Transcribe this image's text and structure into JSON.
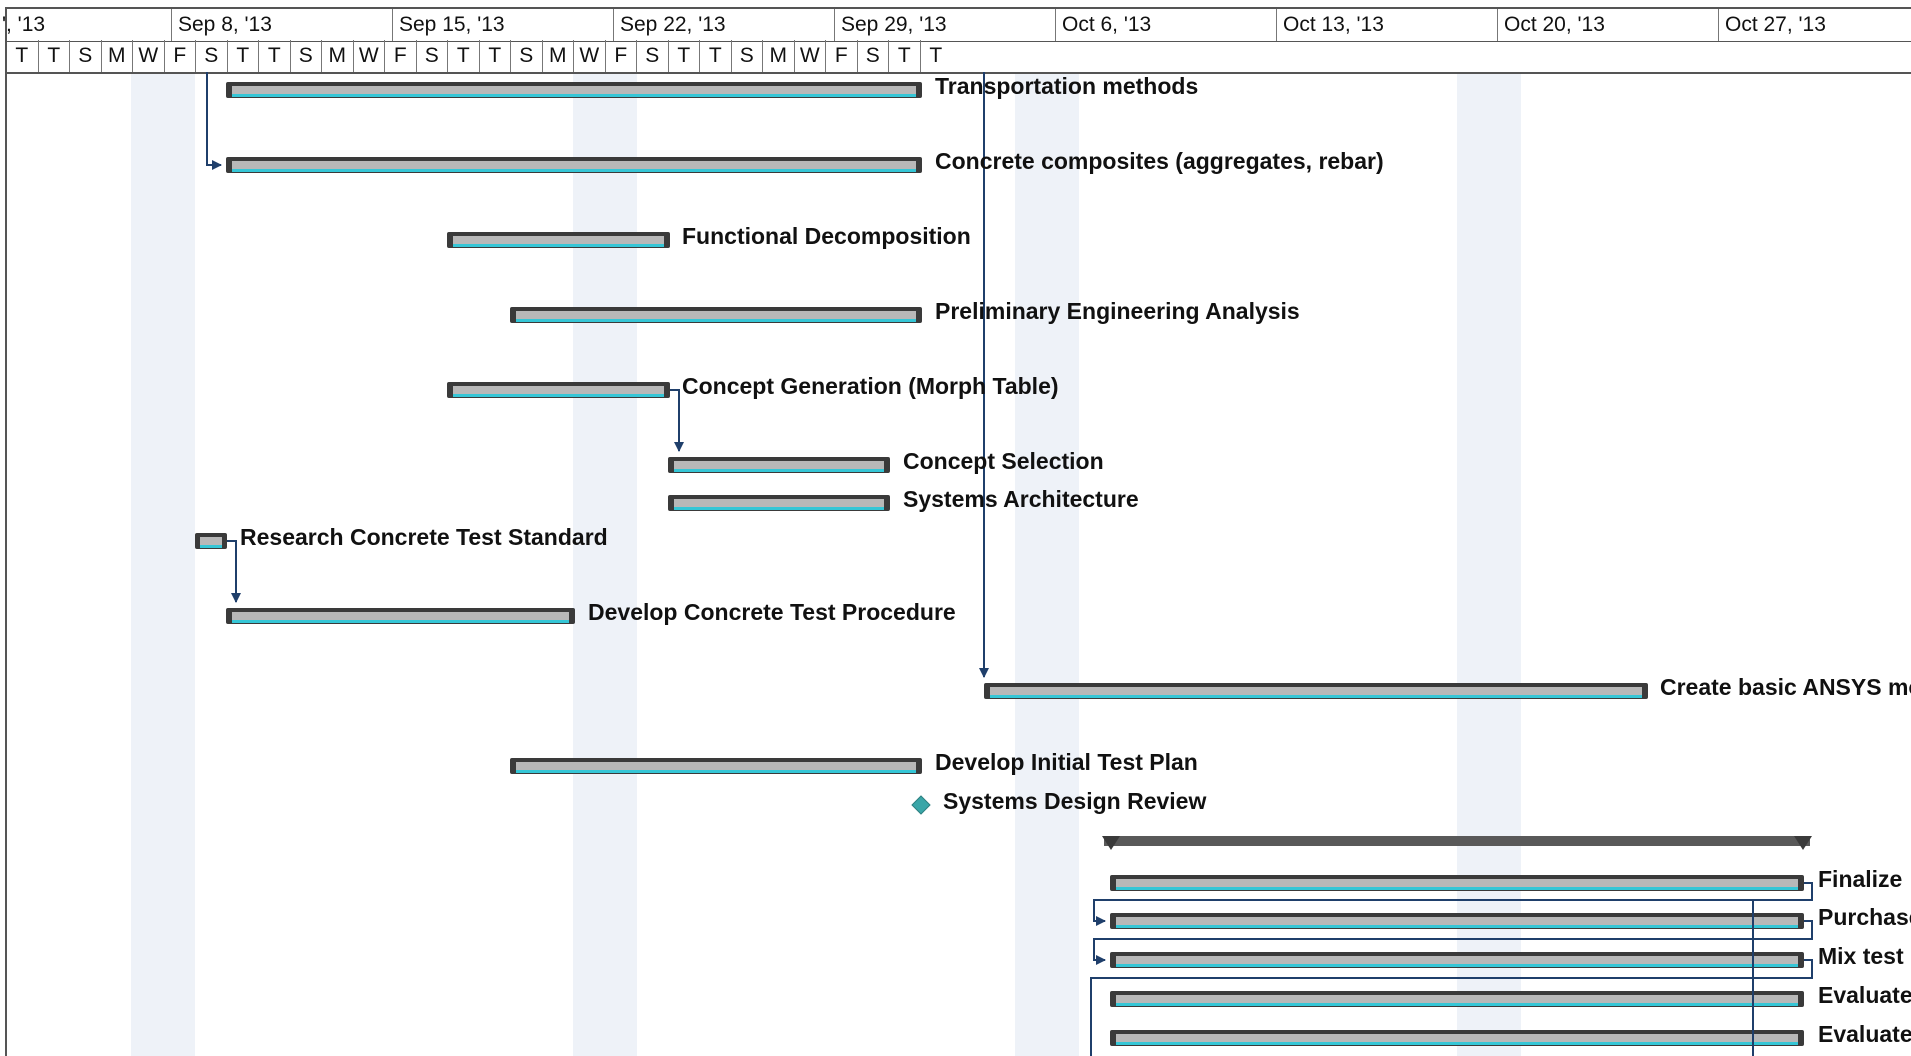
{
  "timescale": {
    "weeks": [
      "', '13",
      "Sep 8, '13",
      "Sep 15, '13",
      "Sep 22, '13",
      "Sep 29, '13",
      "Oct 6, '13",
      "Oct 13, '13",
      "Oct 20, '13",
      "Oct 27, '13"
    ],
    "days": [
      "T",
      "T",
      "S",
      "M",
      "W",
      "F",
      "S",
      "T",
      "T",
      "S",
      "M",
      "W",
      "F",
      "S",
      "T",
      "T",
      "S",
      "M",
      "W",
      "F",
      "S",
      "T",
      "T",
      "S",
      "M",
      "W",
      "F",
      "S",
      "T",
      "T"
    ]
  },
  "tasks": [
    {
      "label": "Transportation methods"
    },
    {
      "label": "Concrete composites (aggregates, rebar)"
    },
    {
      "label": "Functional Decomposition"
    },
    {
      "label": "Preliminary Engineering Analysis"
    },
    {
      "label": "Concept Generation (Morph Table)"
    },
    {
      "label": "Concept Selection"
    },
    {
      "label": "Systems Architecture"
    },
    {
      "label": "Research Concrete Test Standard"
    },
    {
      "label": "Develop Concrete Test Procedure"
    },
    {
      "label": "Create basic ANSYS mo"
    },
    {
      "label": "Develop Initial Test Plan"
    },
    {
      "label": "Systems Design Review"
    },
    {
      "label": ""
    },
    {
      "label": "Finalize"
    },
    {
      "label": "Purchase"
    },
    {
      "label": "Mix test"
    },
    {
      "label": "Evaluate"
    },
    {
      "label": "Evaluate"
    }
  ],
  "colors": {
    "bar_gray": "#b8b8b8",
    "bar_cyan": "#35c6d6",
    "bar_dark": "#3a3a3a",
    "link": "#1f3f6b",
    "milestone": "#3aa6a8",
    "shade": "#eef2f8"
  }
}
